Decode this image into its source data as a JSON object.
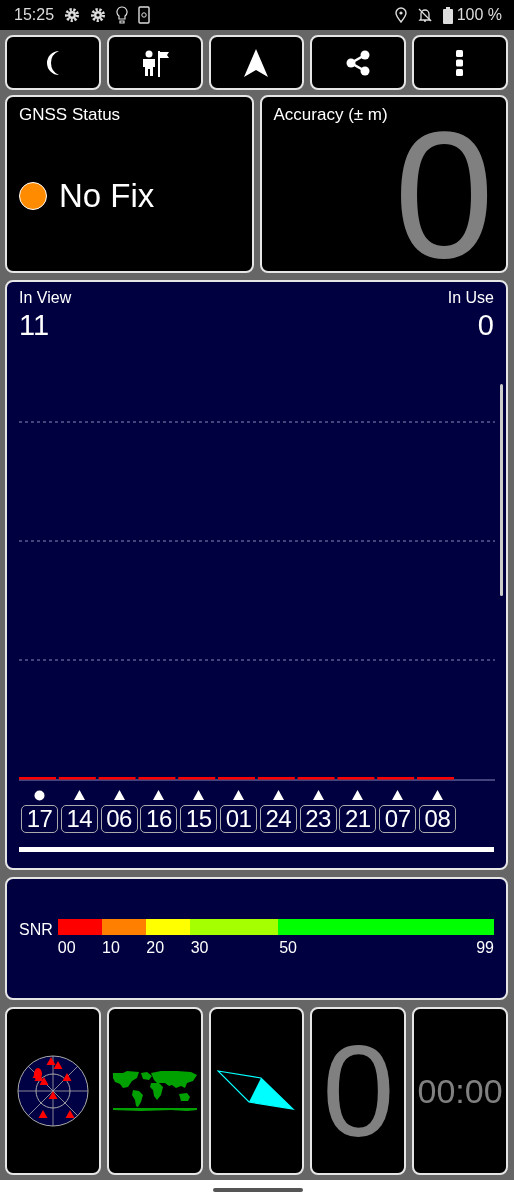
{
  "status_bar": {
    "time": "15:25",
    "battery": "100 %"
  },
  "gnss_status": {
    "title": "GNSS Status",
    "status": "No Fix"
  },
  "accuracy": {
    "title": "Accuracy (± m)",
    "value": "0"
  },
  "satellites": {
    "in_view_label": "In View",
    "in_view": "11",
    "in_use_label": "In Use",
    "in_use": "0",
    "items": [
      {
        "id": "17",
        "kind": "dot"
      },
      {
        "id": "14",
        "kind": "triangle"
      },
      {
        "id": "06",
        "kind": "triangle"
      },
      {
        "id": "16",
        "kind": "triangle"
      },
      {
        "id": "15",
        "kind": "triangle"
      },
      {
        "id": "01",
        "kind": "triangle"
      },
      {
        "id": "24",
        "kind": "triangle"
      },
      {
        "id": "23",
        "kind": "triangle"
      },
      {
        "id": "21",
        "kind": "triangle"
      },
      {
        "id": "07",
        "kind": "triangle"
      },
      {
        "id": "08",
        "kind": "triangle"
      }
    ]
  },
  "snr": {
    "label": "SNR",
    "segments": [
      {
        "label": "00",
        "color": "#ff0000"
      },
      {
        "label": "10",
        "color": "#ff8000"
      },
      {
        "label": "20",
        "color": "#ffff00"
      },
      {
        "label": "30",
        "color": "#a6ff00"
      },
      {
        "label": "50",
        "color": "#00ff00"
      }
    ],
    "end_label": "99"
  },
  "tiles": {
    "speed": "0",
    "time": "00:00"
  }
}
